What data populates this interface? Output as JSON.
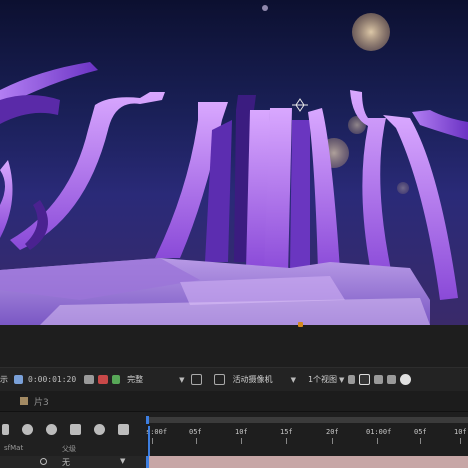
{
  "toolbar": {
    "left_label": "示",
    "timecode": "0:00:01:20",
    "resolution": "完整",
    "camera": "活动摄像机",
    "views": "1个视图",
    "icons": [
      "camera-icon",
      "color-channel-icon",
      "grid-icon",
      "region-icon",
      "3d-view-icon",
      "layout-icon",
      "snapshot-icon",
      "reset-icon"
    ]
  },
  "comp_tab": {
    "label": "片3",
    "color": "#a38a63"
  },
  "timeline": {
    "header_icons": [
      "current-time-icon",
      "comp-icon",
      "shy-icon",
      "frame-blend-icon",
      "motion-blur-icon",
      "graph-editor-icon"
    ],
    "columns": {
      "left": "sfMat",
      "parent": "父级"
    },
    "layer_row": {
      "parent": "无"
    },
    "ruler_ticks": [
      "s:00f",
      "05f",
      "10f",
      "15f",
      "20f",
      "01:00f",
      "05f",
      "10f"
    ],
    "layer_bar_color": "#c7a6a6"
  }
}
